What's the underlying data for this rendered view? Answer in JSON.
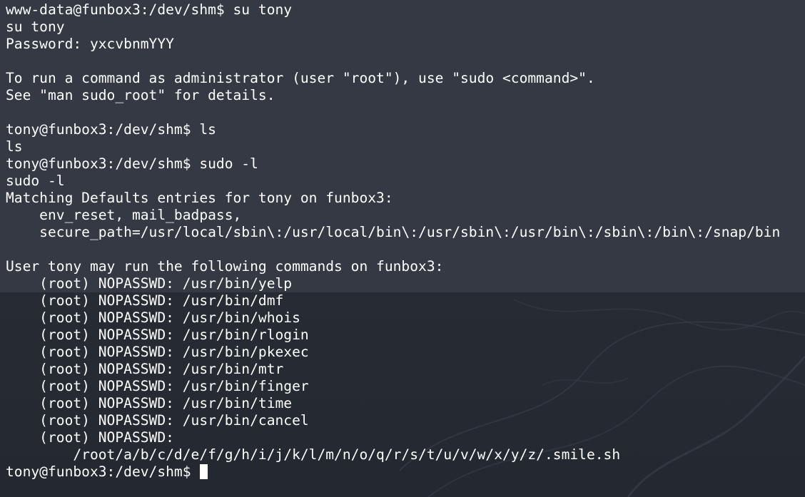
{
  "terminal": {
    "lines": [
      "www-data@funbox3:/dev/shm$ su tony",
      "su tony",
      "Password: yxcvbnmYYY",
      "",
      "To run a command as administrator (user \"root\"), use \"sudo <command>\".",
      "See \"man sudo_root\" for details.",
      "",
      "tony@funbox3:/dev/shm$ ls",
      "ls",
      "tony@funbox3:/dev/shm$ sudo -l",
      "sudo -l",
      "Matching Defaults entries for tony on funbox3:",
      "    env_reset, mail_badpass,",
      "    secure_path=/usr/local/sbin\\:/usr/local/bin\\:/usr/sbin\\:/usr/bin\\:/sbin\\:/bin\\:/snap/bin",
      "",
      "User tony may run the following commands on funbox3:",
      "    (root) NOPASSWD: /usr/bin/yelp",
      "    (root) NOPASSWD: /usr/bin/dmf",
      "    (root) NOPASSWD: /usr/bin/whois",
      "    (root) NOPASSWD: /usr/bin/rlogin",
      "    (root) NOPASSWD: /usr/bin/pkexec",
      "    (root) NOPASSWD: /usr/bin/mtr",
      "    (root) NOPASSWD: /usr/bin/finger",
      "    (root) NOPASSWD: /usr/bin/time",
      "    (root) NOPASSWD: /usr/bin/cancel",
      "    (root) NOPASSWD:",
      "        /root/a/b/c/d/e/f/g/h/i/j/k/l/m/n/o/q/r/s/t/u/v/w/x/y/z/.smile.sh"
    ],
    "prompt": "tony@funbox3:/dev/shm$ ",
    "text_color": "#ffffff",
    "background_color": "#343943"
  }
}
